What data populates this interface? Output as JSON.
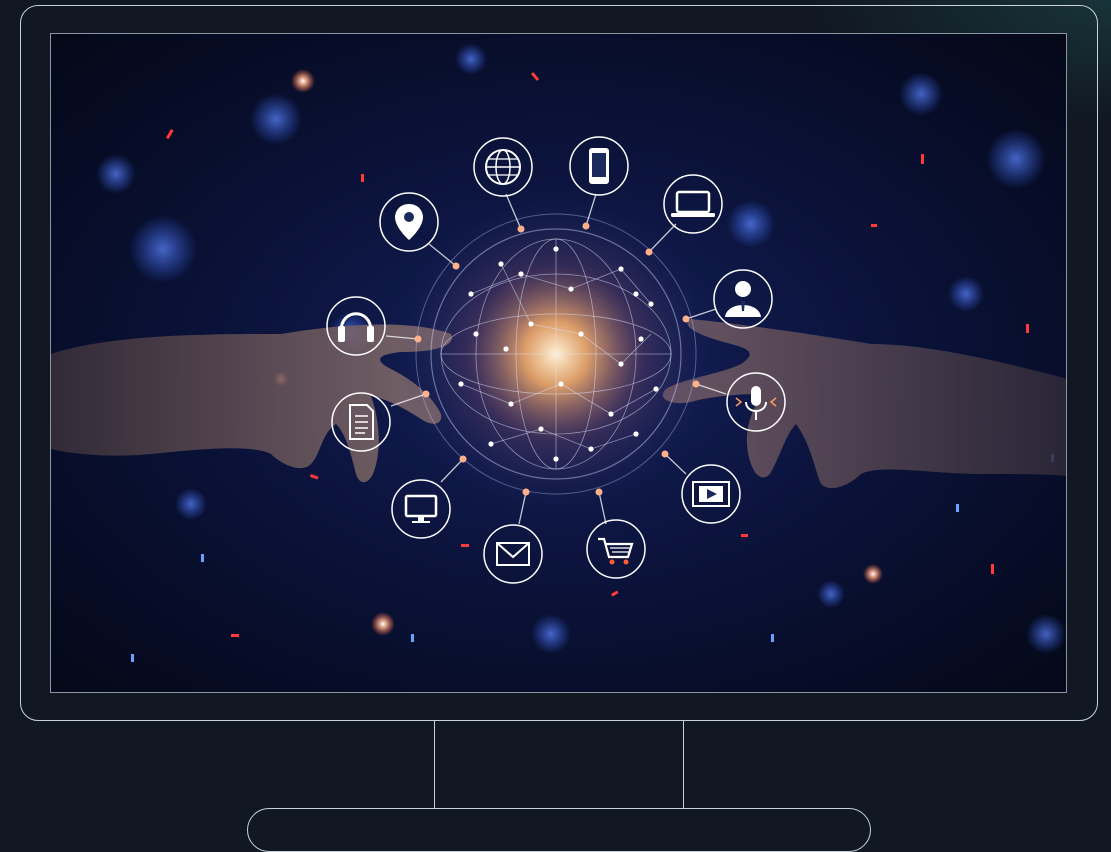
{
  "colors": {
    "page_background": "#111822",
    "frame_stroke": "#c9d2dc",
    "screen_background": "#050a1d",
    "glow_core": "#ffd9a0",
    "node_accent": "#ff9a5c",
    "bokeh_blue": "#3d6cff",
    "spark_red": "#ff3a3a"
  },
  "scene": {
    "description_type": "stock-image",
    "icons": [
      "globe-icon",
      "smartphone-icon",
      "laptop-icon",
      "user-icon",
      "location-pin-icon",
      "headphones-icon",
      "document-icon",
      "microphone-icon",
      "monitor-icon",
      "email-icon",
      "shopping-cart-icon",
      "video-play-icon"
    ]
  }
}
